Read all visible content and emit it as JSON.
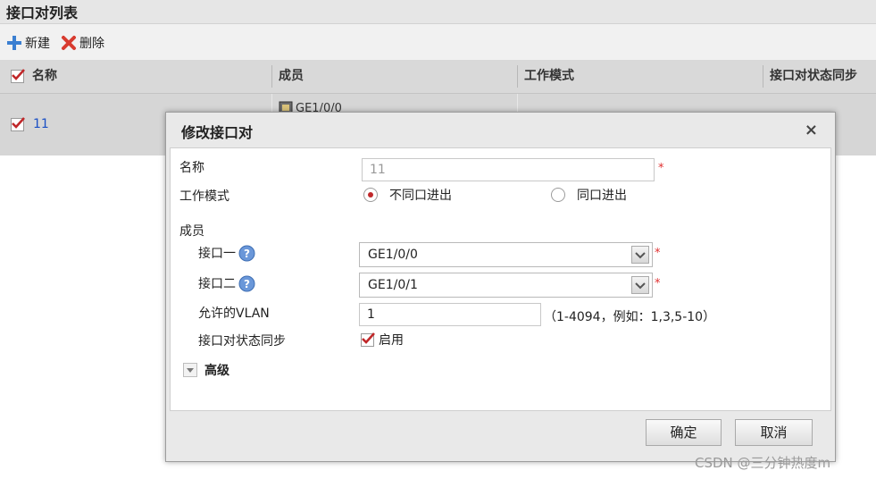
{
  "panel": {
    "title": "接口对列表"
  },
  "toolbar": {
    "new_label": "新建",
    "delete_label": "删除"
  },
  "table": {
    "columns": [
      "名称",
      "成员",
      "工作模式",
      "接口对状态同步"
    ],
    "rows": [
      {
        "name": "11",
        "member": "GE1/0/0"
      }
    ]
  },
  "dialog": {
    "title": "修改接口对",
    "close": "×",
    "name_label": "名称",
    "name_value": "11",
    "required_mark": "*",
    "mode_label": "工作模式",
    "mode_options": [
      "不同口进出",
      "同口进出"
    ],
    "mode_selected": "不同口进出",
    "members_label": "成员",
    "if1_label": "接口一",
    "if1_value": "GE1/0/0",
    "if2_label": "接口二",
    "if2_value": "GE1/0/1",
    "vlan_label": "允许的VLAN",
    "vlan_value": "1",
    "vlan_hint": "（1-4094，例如：1,3,5-10）",
    "sync_label": "接口对状态同步",
    "sync_option": "启用",
    "sync_checked": true,
    "advanced_label": "高级",
    "ok_label": "确定",
    "cancel_label": "取消"
  },
  "watermark": "CSDN @三分钟热度m",
  "colors": {
    "accent_red": "#c0282a",
    "link_blue": "#1a4fc4"
  }
}
